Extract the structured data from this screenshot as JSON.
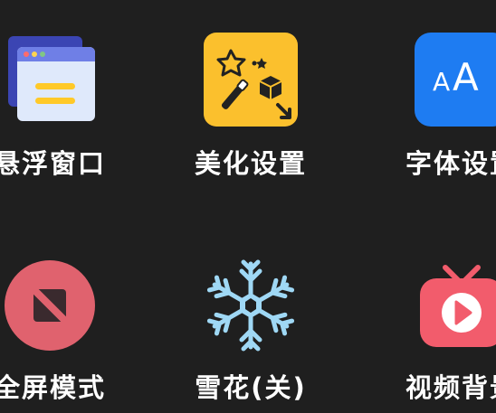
{
  "menu": {
    "items": [
      {
        "label": "悬浮窗口",
        "icon": "floating-window-icon"
      },
      {
        "label": "美化设置",
        "icon": "magic-wand-icon"
      },
      {
        "label": "字体设置",
        "icon": "font-icon",
        "glyph": "AA"
      },
      {
        "label": "全屏模式",
        "icon": "fullscreen-icon"
      },
      {
        "label": "雪花(关)",
        "icon": "snowflake-icon"
      },
      {
        "label": "视频背景",
        "icon": "tv-play-icon"
      }
    ]
  },
  "colors": {
    "background": "#1f1f1f",
    "floating_window": "#4b59c9",
    "beautify": "#fbc02d",
    "font": "#1e7cf2",
    "fullscreen": "#e0626e",
    "snowflake": "#9fd8f5",
    "video": "#f25c6c"
  }
}
